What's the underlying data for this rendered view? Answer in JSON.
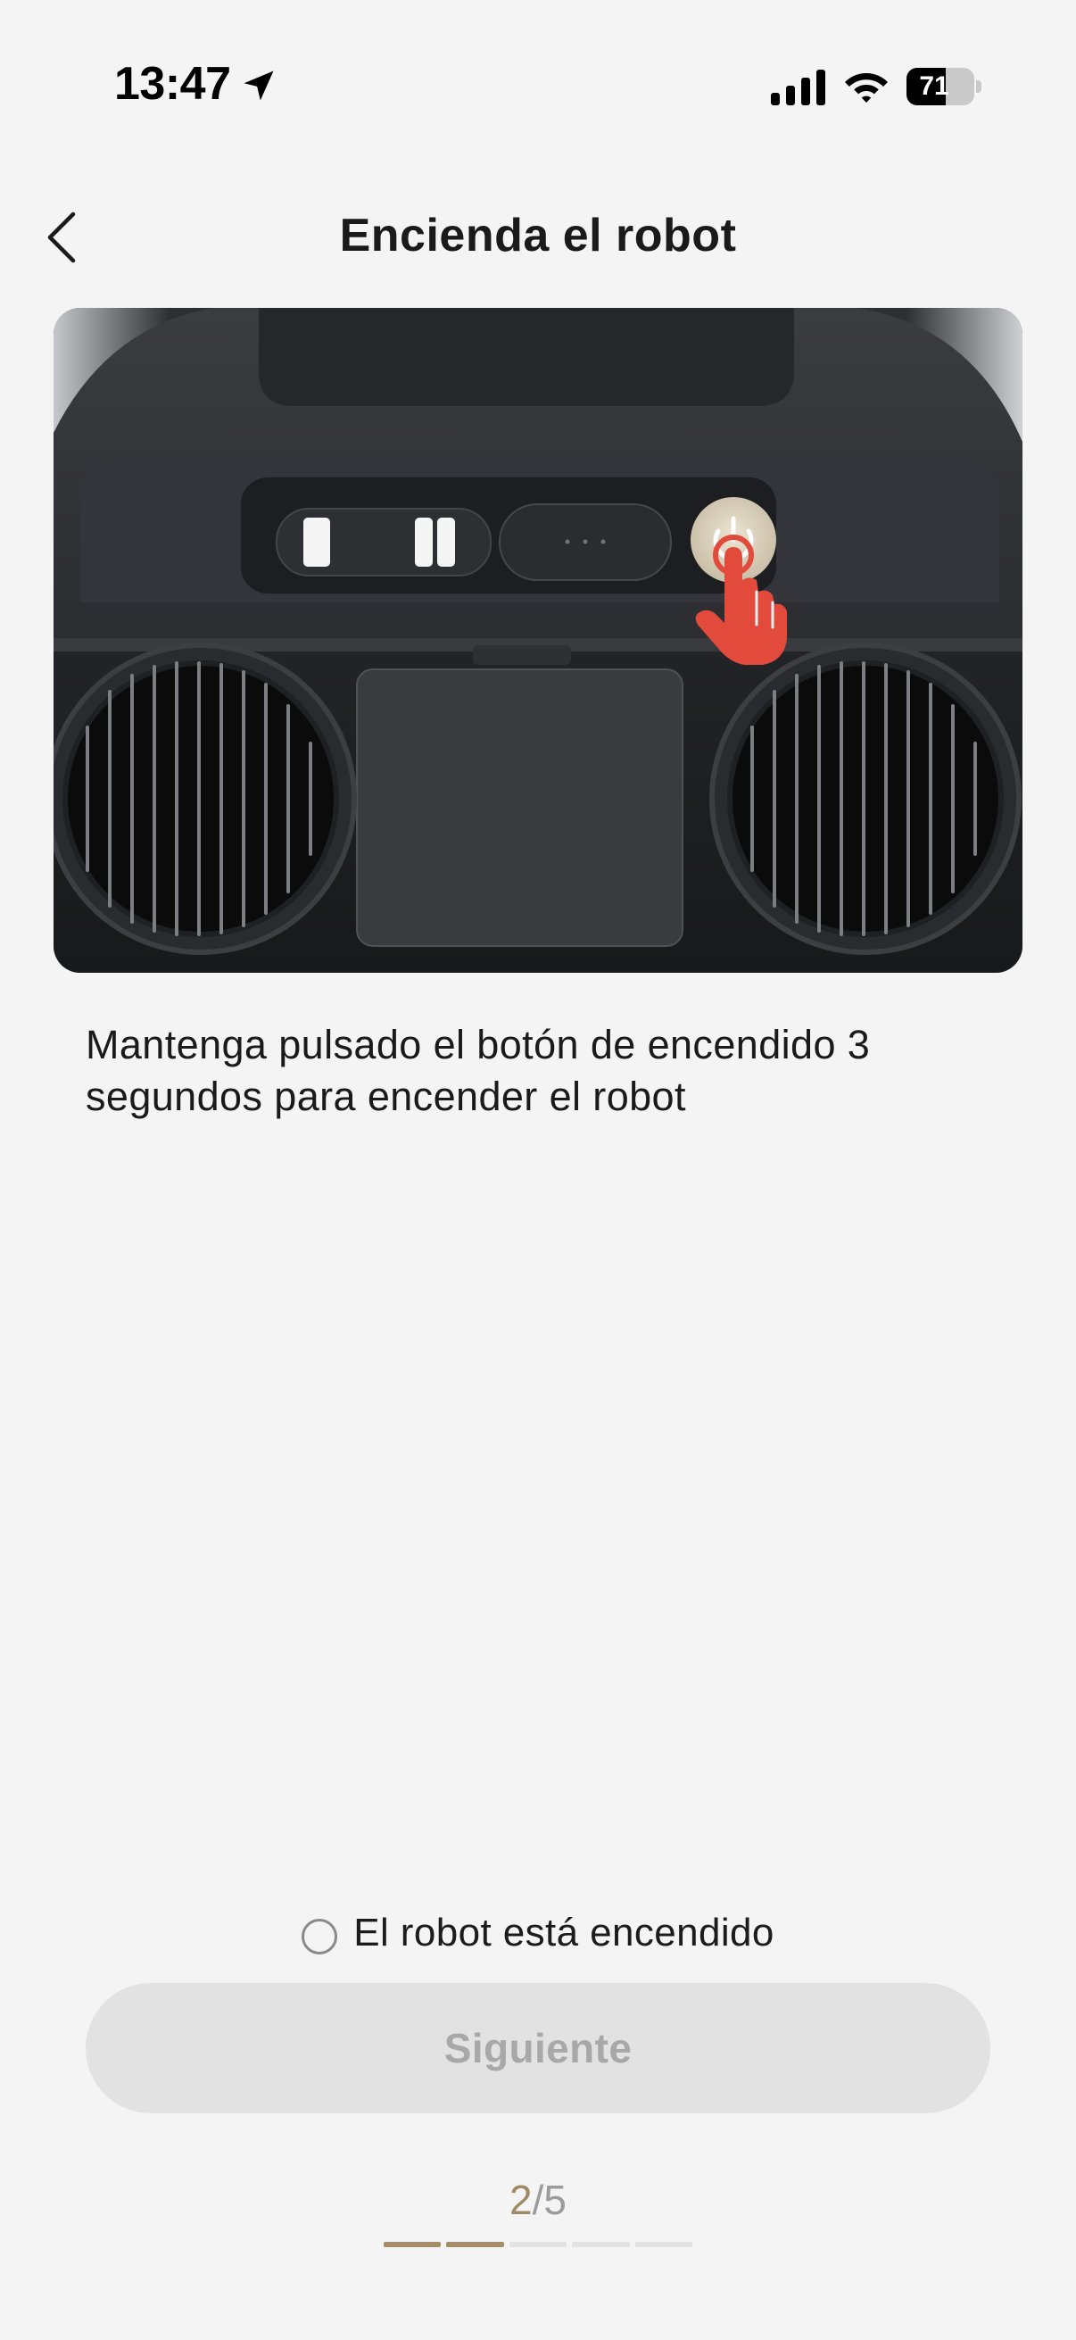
{
  "status_bar": {
    "time": "13:47",
    "battery_level": "71",
    "battery_fraction": 0.71,
    "icons": [
      "location-arrow-icon",
      "cellular-signal-icon",
      "wifi-icon",
      "battery-icon"
    ]
  },
  "nav": {
    "back_icon": "chevron-left-icon",
    "title": "Encienda el robot"
  },
  "illustration": {
    "subject": "robot-top-panel-power-button",
    "accent_color": "#e24a3b"
  },
  "instruction": "Mantenga pulsado el botón de encendido 3 segundos para encender el robot",
  "confirm": {
    "label": "El robot está encendido",
    "checked": false
  },
  "next_button": {
    "label": "Siguiente",
    "enabled": false
  },
  "steps": {
    "current": "2",
    "separator_total": "/5",
    "current_step": 2,
    "total_steps": 5
  },
  "colors": {
    "background": "#f4f4f4",
    "accent": "#a58d6a",
    "button_disabled": "#e2e2e2",
    "button_text_disabled": "#a8a8a8"
  }
}
